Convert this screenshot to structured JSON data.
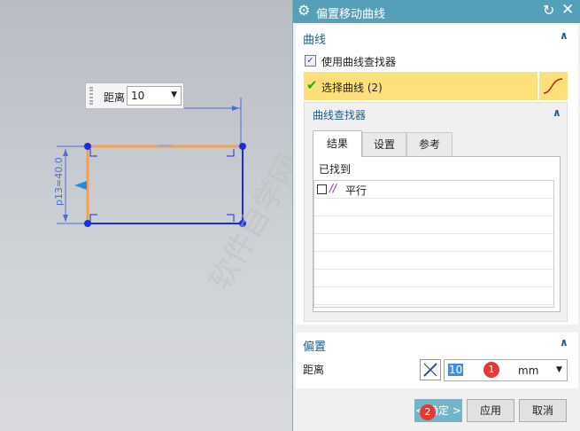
{
  "viewport": {
    "popup_label": "距离",
    "popup_value": "10",
    "dimension_label": "p13=40.0"
  },
  "watermark": "软件自学网 WWW.RJZXW.COM",
  "dialog": {
    "title": "偏置移动曲线",
    "curve_section": {
      "title": "曲线",
      "use_finder_label": "使用曲线查找器",
      "use_finder_checked": true,
      "select_label": "选择曲线 (2)"
    },
    "finder": {
      "title": "曲线查找器",
      "tabs": [
        "结果",
        "设置",
        "参考"
      ],
      "found_label": "已找到",
      "items": [
        {
          "label": "平行",
          "checked": false
        }
      ]
    },
    "offset_section": {
      "title": "偏置",
      "distance_label": "距离",
      "distance_value": "10",
      "unit": "mm"
    },
    "buttons": {
      "ok": "< 确定 >",
      "apply": "应用",
      "cancel": "取消"
    },
    "badges": [
      "1",
      "2"
    ]
  }
}
